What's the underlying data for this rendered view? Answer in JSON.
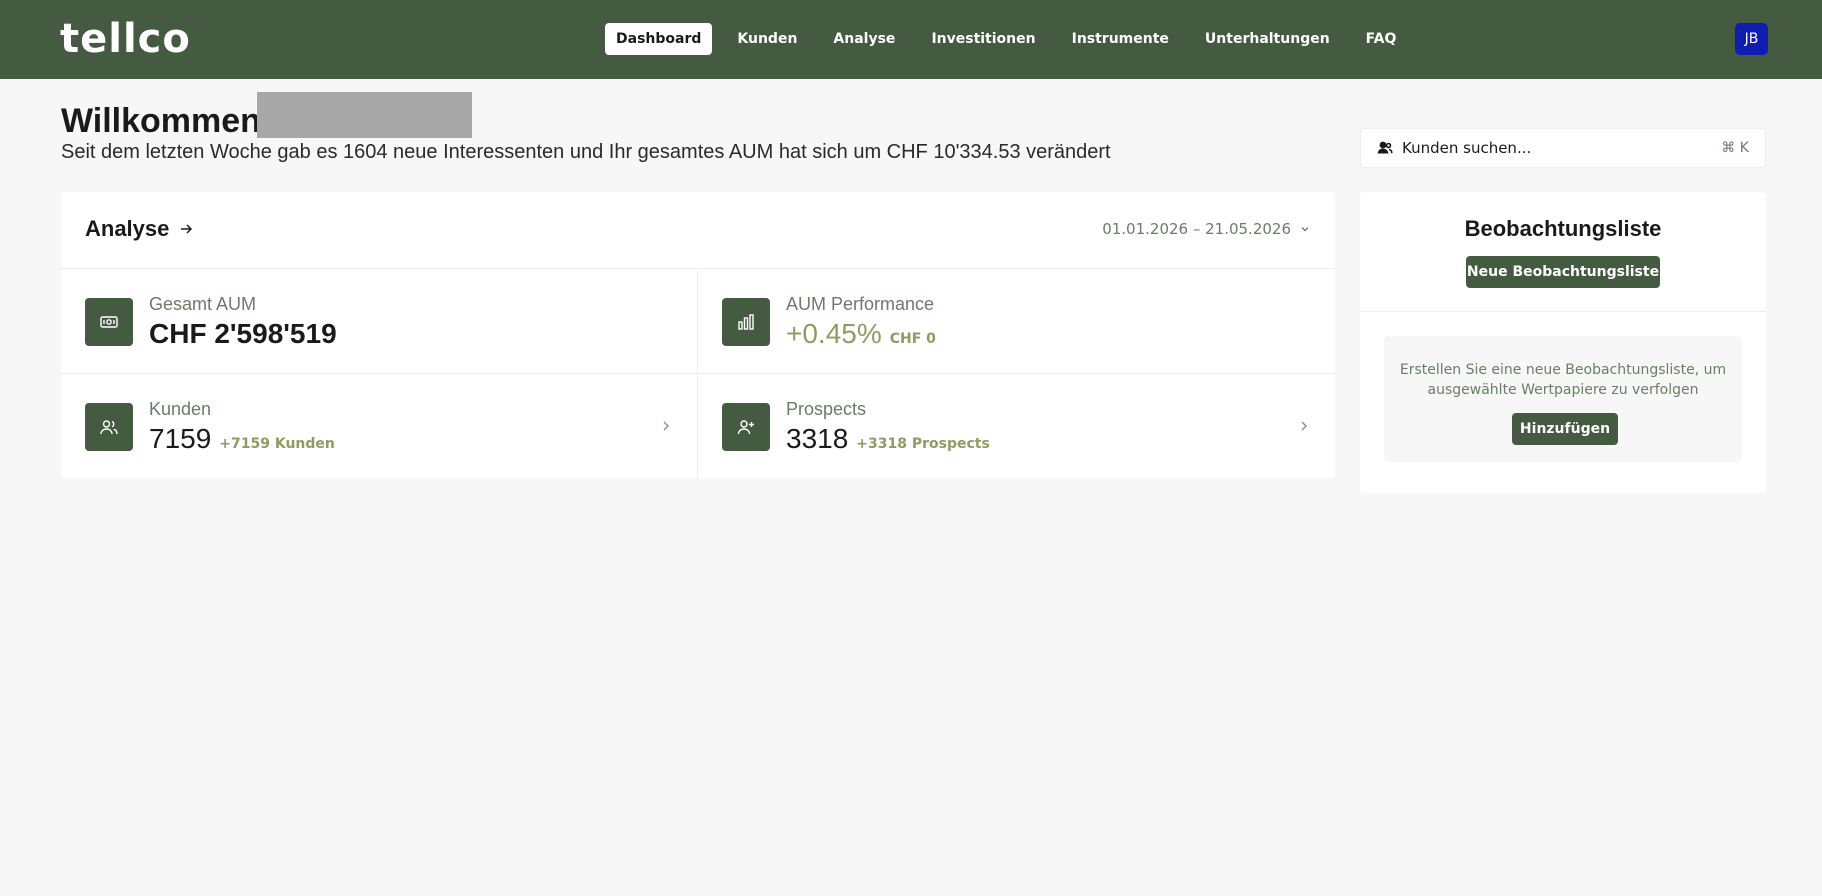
{
  "app": {
    "logo": "tellco",
    "nav": [
      {
        "label": "Dashboard",
        "active": true
      },
      {
        "label": "Kunden",
        "active": false
      },
      {
        "label": "Analyse",
        "active": false
      },
      {
        "label": "Investitionen",
        "active": false
      },
      {
        "label": "Instrumente",
        "active": false
      },
      {
        "label": "Unterhaltungen",
        "active": false
      },
      {
        "label": "FAQ",
        "active": false
      }
    ],
    "avatar_initials": "JB"
  },
  "welcome": {
    "greeting": "Willkommen,",
    "subtitle": "Seit dem letzten Woche gab es 1604 neue Interessenten und Ihr gesamtes AUM hat sich um CHF 10'334.53 verändert"
  },
  "search": {
    "placeholder": "Kunden suchen...",
    "shortcut": "⌘ K"
  },
  "analyse": {
    "title": "Analyse",
    "date_range": "01.01.2026 – 21.05.2026",
    "stats": {
      "total_aum": {
        "label": "Gesamt AUM",
        "value": "CHF 2'598'519"
      },
      "aum_performance": {
        "label": "AUM Performance",
        "value": "+0.45%",
        "delta": "CHF 0"
      },
      "kunden": {
        "label": "Kunden",
        "value": "7159",
        "delta": "+7159 Kunden"
      },
      "prospects": {
        "label": "Prospects",
        "value": "3318",
        "delta": "+3318 Prospects"
      }
    }
  },
  "watchlist": {
    "title": "Beobachtungsliste",
    "new_button": "Neue Beobachtungsliste",
    "empty_text": "Erstellen Sie eine neue Beobachtungsliste, um ausgewählte Wertpapiere zu verfolgen",
    "add_button": "Hinzufügen"
  },
  "colors": {
    "brand": "#445a41",
    "accent_green": "#8d9d5f",
    "avatar": "#0f1eb0"
  }
}
